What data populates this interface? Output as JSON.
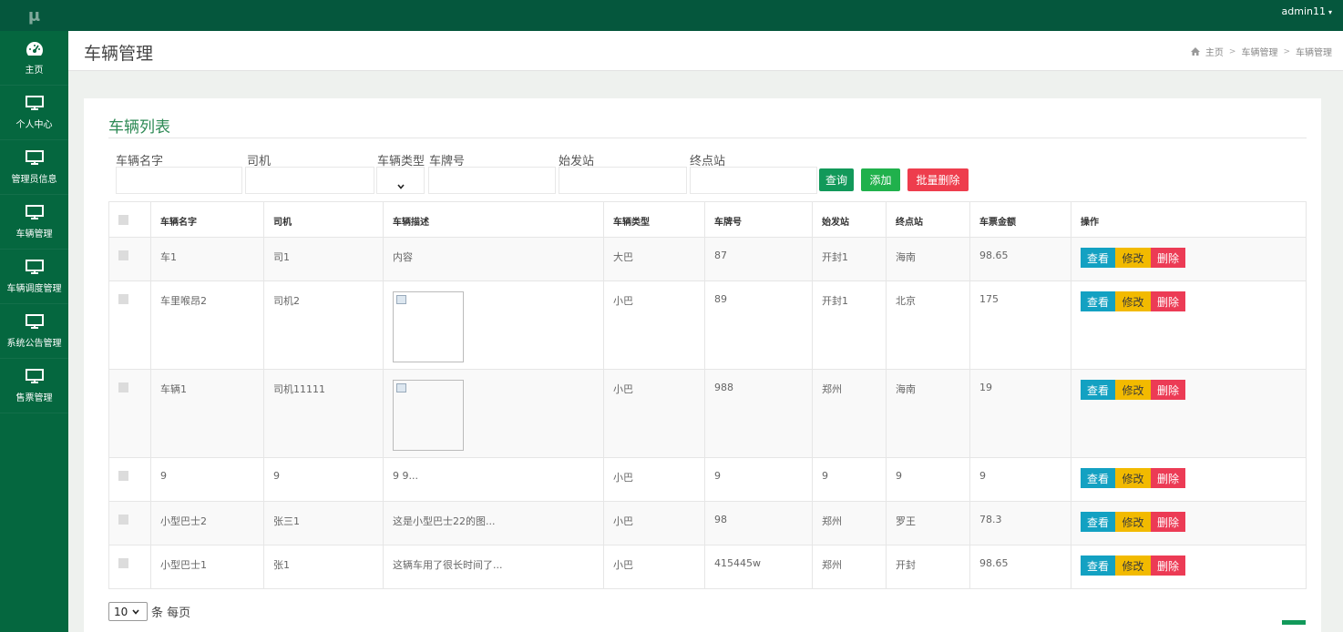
{
  "app": {
    "logo": "μ",
    "user_menu": "admin11",
    "user_caret": "▾"
  },
  "sidebar": {
    "items": [
      {
        "label": "主页",
        "icon": "dashboard-icon"
      },
      {
        "label": "个人中心",
        "icon": "monitor-icon"
      },
      {
        "label": "管理员信息",
        "icon": "monitor-icon"
      },
      {
        "label": "车辆管理",
        "icon": "monitor-icon"
      },
      {
        "label": "车辆调度管理",
        "icon": "monitor-icon"
      },
      {
        "label": "系统公告管理",
        "icon": "monitor-icon"
      },
      {
        "label": "售票管理",
        "icon": "monitor-icon"
      }
    ]
  },
  "header": {
    "title": "车辆管理",
    "breadcrumb": {
      "home": "主页",
      "sep1": ">",
      "level1": "车辆管理",
      "sep2": ">",
      "level2": "车辆管理"
    }
  },
  "panel": {
    "title": "车辆列表"
  },
  "filters": {
    "vehicle_name": "车辆名字",
    "driver": "司机",
    "vehicle_type": "车辆类型",
    "plate": "车牌号",
    "origin": "始发站",
    "destination": "终点站"
  },
  "buttons": {
    "query": "查询",
    "add": "添加",
    "batch_delete": "批量删除"
  },
  "table": {
    "headers": [
      "车辆名字",
      "司机",
      "车辆描述",
      "车辆类型",
      "车牌号",
      "始发站",
      "终点站",
      "车票金额",
      "操作"
    ],
    "rows": [
      {
        "name": "车1",
        "driver": "司1",
        "desc": "内容",
        "type": "大巴",
        "plate": "87",
        "origin": "开封1",
        "dest": "海南",
        "price": "98.65"
      },
      {
        "name": "车里喉昂2",
        "driver": "司机2",
        "desc": "",
        "type": "小巴",
        "plate": "89",
        "origin": "开封1",
        "dest": "北京",
        "price": "175"
      },
      {
        "name": "车辆1",
        "driver": "司机11111",
        "desc": "",
        "type": "小巴",
        "plate": "988",
        "origin": "郑州",
        "dest": "海南",
        "price": "19"
      },
      {
        "name": "9",
        "driver": "9",
        "desc": "9 9...",
        "type": "小巴",
        "plate": "9",
        "origin": "9",
        "dest": "9",
        "price": "9"
      },
      {
        "name": "小型巴士2",
        "driver": "张三1",
        "desc": "这是小型巴士22的图...",
        "type": "小巴",
        "plate": "98",
        "origin": "郑州",
        "dest": "罗王",
        "price": "78.3"
      },
      {
        "name": "小型巴士1",
        "driver": "张1",
        "desc": "这辆车用了很长时间了...",
        "type": "小巴",
        "plate": "415445w",
        "origin": "郑州",
        "dest": "开封",
        "price": "98.65"
      }
    ],
    "actions": {
      "view": "查看",
      "edit": "修改",
      "delete": "删除"
    }
  },
  "pagination": {
    "page_size": "10",
    "per_page_label": "条 每页"
  },
  "colors": {
    "topbar": "#05573d",
    "sidebar": "#05673f",
    "accent_green": "#2e8a55",
    "view": "#13a1c2",
    "edit": "#f2ba00",
    "delete": "#ec3b55"
  }
}
